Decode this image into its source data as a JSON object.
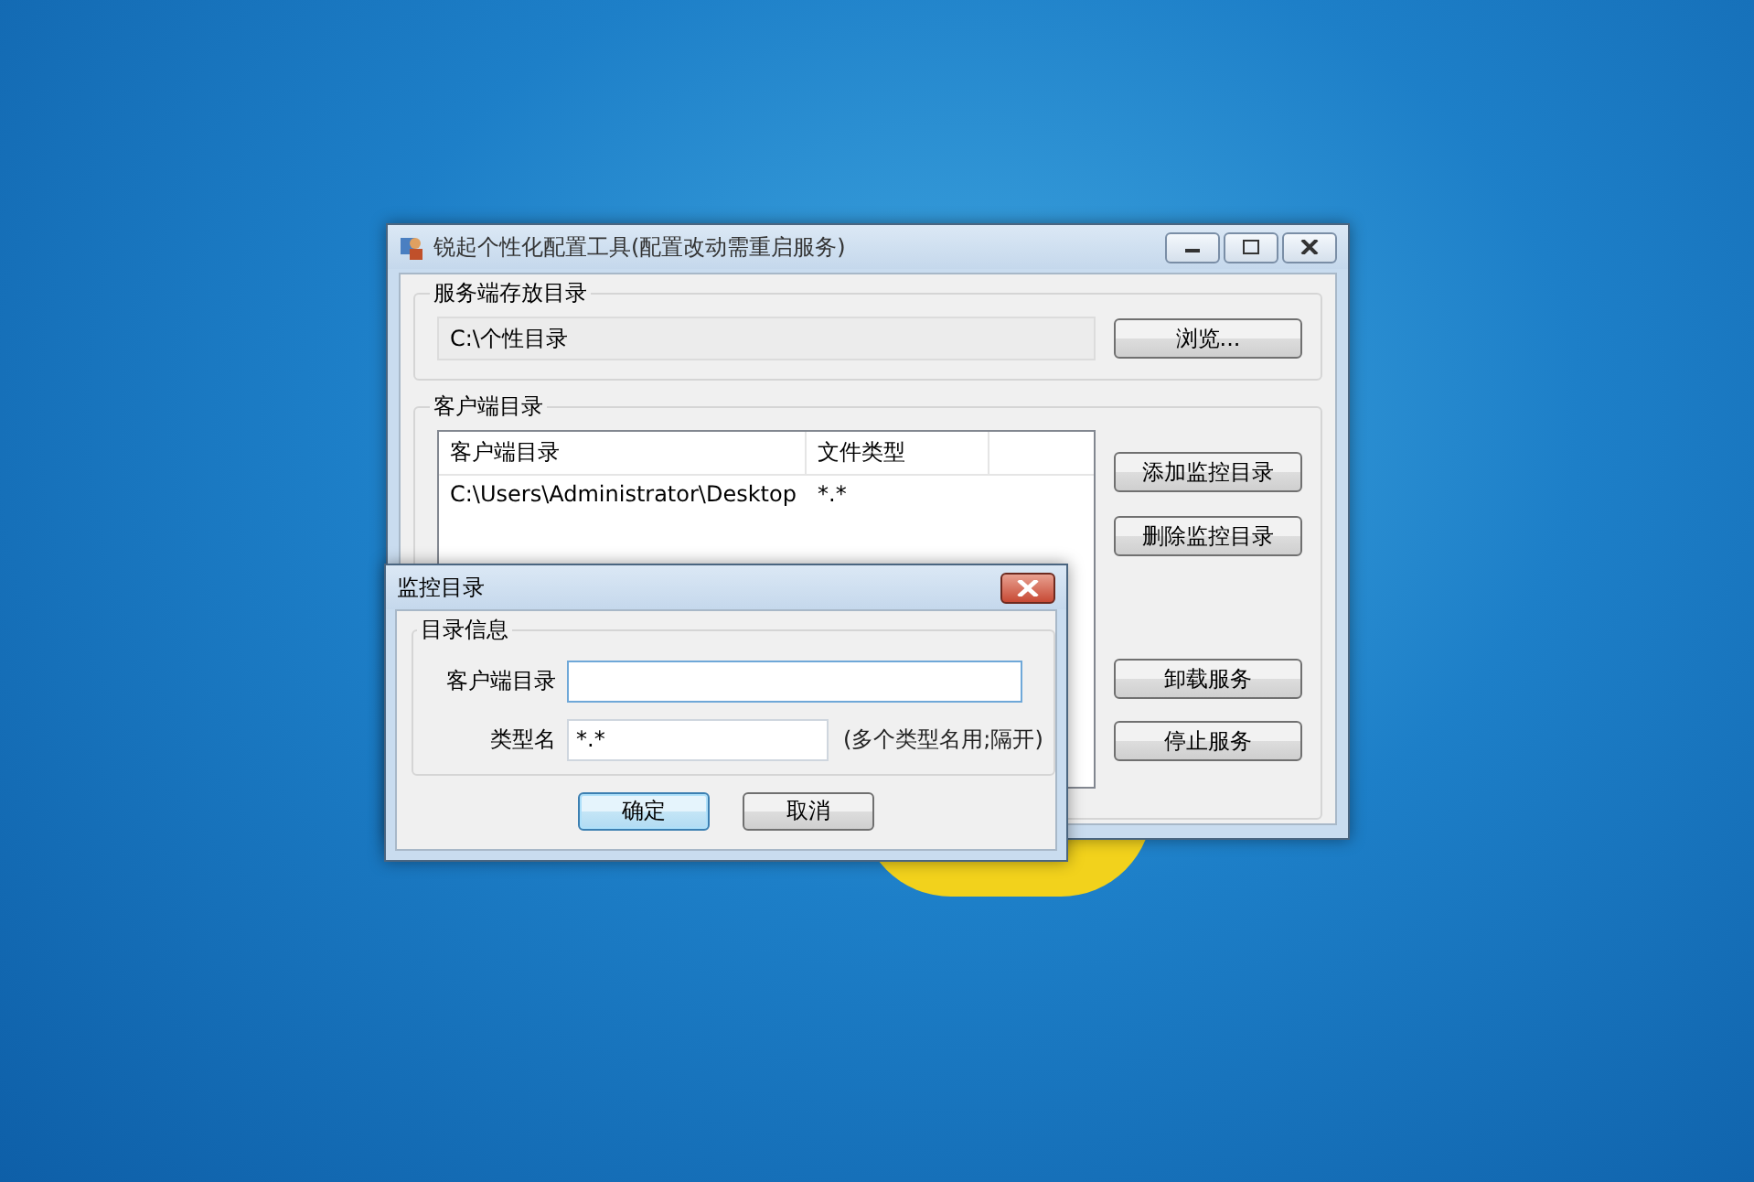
{
  "main_window": {
    "title": "锐起个性化配置工具(配置改动需重启服务)",
    "server_group": {
      "label": "服务端存放目录",
      "path": "C:\\个性目录",
      "browse_button": "浏览..."
    },
    "client_group": {
      "label": "客户端目录",
      "columns": [
        "客户端目录",
        "文件类型"
      ],
      "rows": [
        {
          "cells": [
            "C:\\Users\\Administrator\\Desktop",
            "*.*"
          ]
        }
      ],
      "buttons": [
        "添加监控目录",
        "删除监控目录",
        "卸载服务",
        "停止服务"
      ]
    }
  },
  "dialog": {
    "title": "监控目录",
    "group_label": "目录信息",
    "fields": [
      {
        "label": "客户端目录",
        "focused": true
      },
      {
        "label": "类型名",
        "value": "*.*",
        "focused": false,
        "note": "(多个类型名用;隔开)"
      }
    ],
    "buttons": [
      {
        "label": "确定",
        "default": true
      },
      {
        "label": "取消",
        "default": false
      }
    ]
  }
}
